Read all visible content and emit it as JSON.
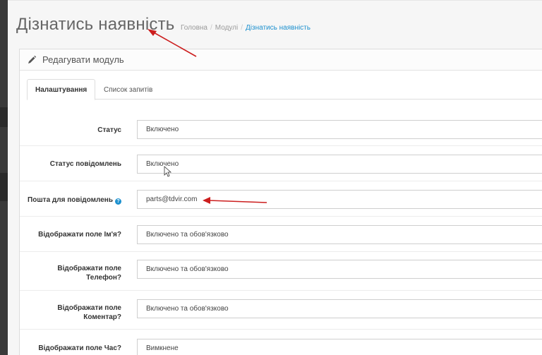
{
  "page": {
    "title": "Дізнатись наявність"
  },
  "breadcrumb": {
    "items": [
      "Головна",
      "Модулі"
    ],
    "separator": "/",
    "active": "Дізнатись наявність"
  },
  "panel": {
    "heading": "Редагувати модуль",
    "icon": "pencil-icon"
  },
  "tabs": [
    {
      "label": "Налаштування",
      "active": true
    },
    {
      "label": "Список запитів",
      "active": false
    }
  ],
  "form": {
    "fields": [
      {
        "label": "Статус",
        "value": "Включено"
      },
      {
        "label": "Статус повідомлень",
        "value": "Включено"
      },
      {
        "label": "Пошта для повідомлень",
        "value": "parts@tdvir.com",
        "help": "?"
      },
      {
        "label": "Відображати поле Ім'я?",
        "value": "Включено та обов'язково"
      },
      {
        "label_line1": "Відображати поле",
        "label_line2": "Телефон?",
        "value": "Включено та обов'язково"
      },
      {
        "label_line1": "Відображати поле",
        "label_line2": "Коментар?",
        "value": "Включено та обов'язково"
      },
      {
        "label": "Відображати поле Час?",
        "value": "Вимкнене"
      }
    ]
  },
  "colors": {
    "accent": "#1e91cf",
    "annotation_arrow": "#cc1e1e"
  }
}
